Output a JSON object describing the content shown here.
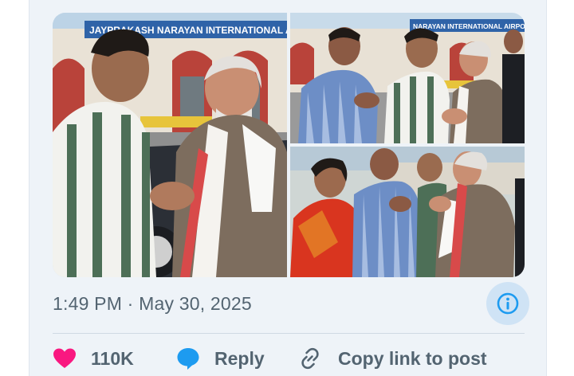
{
  "post": {
    "timestamp": "1:49 PM · May 30, 2025",
    "media": [
      {
        "alt_scene": "photo-1"
      },
      {
        "alt_scene": "photo-2"
      },
      {
        "alt_scene": "photo-3"
      }
    ],
    "airport_sign_1": "JAYPRAKASH NARAYAN INTERNATIONAL AIRPORT",
    "airport_sign_2": "NARAYAN INTERNATIONAL AIRPORT"
  },
  "actions": {
    "like_count": "110K",
    "reply_label": "Reply",
    "copy_label": "Copy link to post"
  },
  "colors": {
    "like": "#f91880",
    "reply": "#1d9bf0",
    "muted": "#536471",
    "info_bg": "#cfe3f5",
    "info_icon": "#1d9bf0"
  },
  "icons": {
    "like": "heart-icon",
    "reply": "speech-bubble-icon",
    "copy": "link-icon",
    "info": "info-icon"
  }
}
